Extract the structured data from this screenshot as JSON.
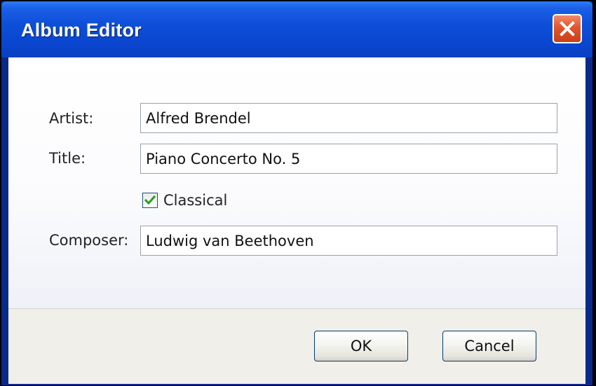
{
  "window": {
    "title": "Album Editor",
    "close_icon": "close-x-icon",
    "colors": {
      "titlebar": "#0a46cf",
      "close_button": "#e2552c",
      "checkmark": "#21a121"
    }
  },
  "form": {
    "artist_label": "Artist:",
    "artist_value": "Alfred Brendel",
    "title_label": "Title:",
    "title_value": "Piano Concerto No. 5",
    "classical_label": "Classical",
    "classical_checked": true,
    "composer_label": "Composer:",
    "composer_value": "Ludwig van Beethoven"
  },
  "buttons": {
    "ok_label": "OK",
    "cancel_label": "Cancel"
  }
}
